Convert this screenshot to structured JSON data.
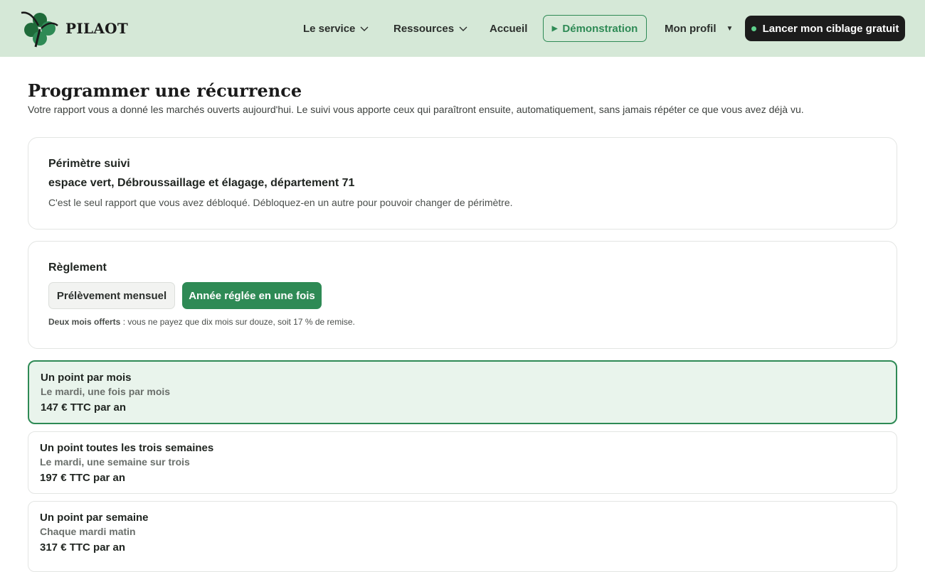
{
  "header": {
    "brand": "PILAOT",
    "nav": {
      "service": "Le service",
      "resources": "Ressources",
      "home": "Accueil",
      "demo": "Démonstration",
      "profile": "Mon profil"
    },
    "cta": "Lancer mon ciblage gratuit"
  },
  "page": {
    "title": "Programmer une récurrence",
    "subtitle": "Votre rapport vous a donné les marchés ouverts aujourd'hui. Le suivi vous apporte ceux qui paraîtront ensuite, automatiquement, sans jamais répéter ce que vous avez déjà vu."
  },
  "scope": {
    "heading": "Périmètre suivi",
    "value": "espace vert, Débroussaillage et élagage, département 71",
    "note": "C'est le seul rapport que vous avez débloqué. Débloquez-en un autre pour pouvoir changer de périmètre."
  },
  "payment": {
    "heading": "Règlement",
    "options": [
      "Prélèvement mensuel",
      "Année réglée en une fois"
    ],
    "selected": "Année réglée en une fois",
    "note_bold": "Deux mois offerts",
    "note_rest": " : vous ne payez que dix mois sur douze, soit 17 % de remise."
  },
  "plans": [
    {
      "title": "Un point par mois",
      "schedule": "Le mardi, une fois par mois",
      "price": "147 € TTC par an",
      "selected": true
    },
    {
      "title": "Un point toutes les trois semaines",
      "schedule": "Le mardi, une semaine sur trois",
      "price": "197 € TTC par an",
      "selected": false
    },
    {
      "title": "Un point par semaine",
      "schedule": "Chaque mardi matin",
      "price": "317 € TTC par an",
      "selected": false
    }
  ],
  "colors": {
    "header_bg": "#d5e8d7",
    "accent": "#2e8a55",
    "cta_bg": "#1c1c1c",
    "selected_plan_bg": "#e9f4ec"
  },
  "icons": [
    "clover-logo-icon",
    "chevron-down-icon",
    "play-icon",
    "caret-down-icon",
    "status-dot-icon"
  ]
}
